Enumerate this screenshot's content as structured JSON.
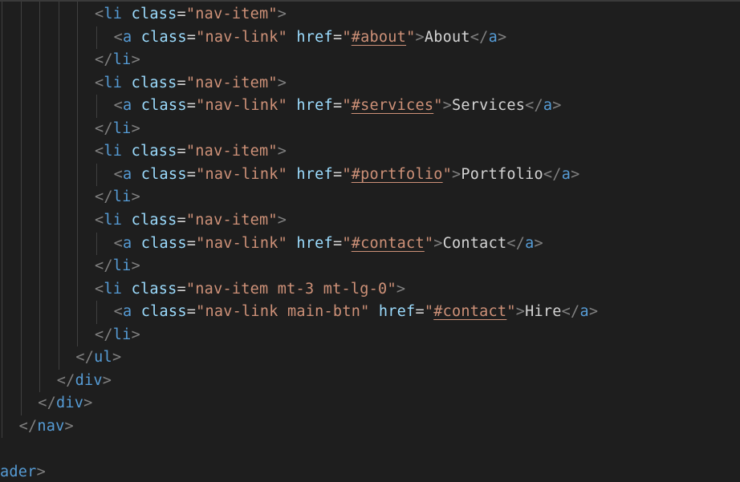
{
  "editor": {
    "lines": [
      {
        "indent": 5,
        "parts": [
          [
            "bracket",
            "<"
          ],
          [
            "tag",
            "li"
          ],
          [
            "sp",
            " "
          ],
          [
            "attr",
            "class"
          ],
          [
            "eq",
            "="
          ],
          [
            "str",
            "\"nav-item\""
          ],
          [
            "bracket",
            ">"
          ]
        ]
      },
      {
        "indent": 6,
        "parts": [
          [
            "bracket",
            "<"
          ],
          [
            "tag",
            "a"
          ],
          [
            "sp",
            " "
          ],
          [
            "attr",
            "class"
          ],
          [
            "eq",
            "="
          ],
          [
            "str",
            "\"nav-link\""
          ],
          [
            "sp",
            " "
          ],
          [
            "attr",
            "href"
          ],
          [
            "eq",
            "="
          ],
          [
            "str",
            "\""
          ],
          [
            "strlink",
            "#about"
          ],
          [
            "str",
            "\""
          ],
          [
            "bracket",
            ">"
          ],
          [
            "text",
            "About"
          ],
          [
            "bracket",
            "</"
          ],
          [
            "tag",
            "a"
          ],
          [
            "bracket",
            ">"
          ]
        ]
      },
      {
        "indent": 5,
        "parts": [
          [
            "bracket",
            "</"
          ],
          [
            "tag",
            "li"
          ],
          [
            "bracket",
            ">"
          ]
        ]
      },
      {
        "indent": 5,
        "parts": [
          [
            "bracket",
            "<"
          ],
          [
            "tag",
            "li"
          ],
          [
            "sp",
            " "
          ],
          [
            "attr",
            "class"
          ],
          [
            "eq",
            "="
          ],
          [
            "str",
            "\"nav-item\""
          ],
          [
            "bracket",
            ">"
          ]
        ]
      },
      {
        "indent": 6,
        "parts": [
          [
            "bracket",
            "<"
          ],
          [
            "tag",
            "a"
          ],
          [
            "sp",
            " "
          ],
          [
            "attr",
            "class"
          ],
          [
            "eq",
            "="
          ],
          [
            "str",
            "\"nav-link\""
          ],
          [
            "sp",
            " "
          ],
          [
            "attr",
            "href"
          ],
          [
            "eq",
            "="
          ],
          [
            "str",
            "\""
          ],
          [
            "strlink",
            "#services"
          ],
          [
            "str",
            "\""
          ],
          [
            "bracket",
            ">"
          ],
          [
            "text",
            "Services"
          ],
          [
            "bracket",
            "</"
          ],
          [
            "tag",
            "a"
          ],
          [
            "bracket",
            ">"
          ]
        ]
      },
      {
        "indent": 5,
        "parts": [
          [
            "bracket",
            "</"
          ],
          [
            "tag",
            "li"
          ],
          [
            "bracket",
            ">"
          ]
        ]
      },
      {
        "indent": 5,
        "parts": [
          [
            "bracket",
            "<"
          ],
          [
            "tag",
            "li"
          ],
          [
            "sp",
            " "
          ],
          [
            "attr",
            "class"
          ],
          [
            "eq",
            "="
          ],
          [
            "str",
            "\"nav-item\""
          ],
          [
            "bracket",
            ">"
          ]
        ]
      },
      {
        "indent": 6,
        "parts": [
          [
            "bracket",
            "<"
          ],
          [
            "tag",
            "a"
          ],
          [
            "sp",
            " "
          ],
          [
            "attr",
            "class"
          ],
          [
            "eq",
            "="
          ],
          [
            "str",
            "\"nav-link\""
          ],
          [
            "sp",
            " "
          ],
          [
            "attr",
            "href"
          ],
          [
            "eq",
            "="
          ],
          [
            "str",
            "\""
          ],
          [
            "strlink",
            "#portfolio"
          ],
          [
            "str",
            "\""
          ],
          [
            "bracket",
            ">"
          ],
          [
            "text",
            "Portfolio"
          ],
          [
            "bracket",
            "</"
          ],
          [
            "tag",
            "a"
          ],
          [
            "bracket",
            ">"
          ]
        ]
      },
      {
        "indent": 5,
        "parts": [
          [
            "bracket",
            "</"
          ],
          [
            "tag",
            "li"
          ],
          [
            "bracket",
            ">"
          ]
        ]
      },
      {
        "indent": 5,
        "parts": [
          [
            "bracket",
            "<"
          ],
          [
            "tag",
            "li"
          ],
          [
            "sp",
            " "
          ],
          [
            "attr",
            "class"
          ],
          [
            "eq",
            "="
          ],
          [
            "str",
            "\"nav-item\""
          ],
          [
            "bracket",
            ">"
          ]
        ]
      },
      {
        "indent": 6,
        "parts": [
          [
            "bracket",
            "<"
          ],
          [
            "tag",
            "a"
          ],
          [
            "sp",
            " "
          ],
          [
            "attr",
            "class"
          ],
          [
            "eq",
            "="
          ],
          [
            "str",
            "\"nav-link\""
          ],
          [
            "sp",
            " "
          ],
          [
            "attr",
            "href"
          ],
          [
            "eq",
            "="
          ],
          [
            "str",
            "\""
          ],
          [
            "strlink",
            "#contact"
          ],
          [
            "str",
            "\""
          ],
          [
            "bracket",
            ">"
          ],
          [
            "text",
            "Contact"
          ],
          [
            "bracket",
            "</"
          ],
          [
            "tag",
            "a"
          ],
          [
            "bracket",
            ">"
          ]
        ]
      },
      {
        "indent": 5,
        "parts": [
          [
            "bracket",
            "</"
          ],
          [
            "tag",
            "li"
          ],
          [
            "bracket",
            ">"
          ]
        ]
      },
      {
        "indent": 5,
        "parts": [
          [
            "bracket",
            "<"
          ],
          [
            "tag",
            "li"
          ],
          [
            "sp",
            " "
          ],
          [
            "attr",
            "class"
          ],
          [
            "eq",
            "="
          ],
          [
            "str",
            "\"nav-item mt-3 mt-lg-0\""
          ],
          [
            "bracket",
            ">"
          ]
        ]
      },
      {
        "indent": 6,
        "parts": [
          [
            "bracket",
            "<"
          ],
          [
            "tag",
            "a"
          ],
          [
            "sp",
            " "
          ],
          [
            "attr",
            "class"
          ],
          [
            "eq",
            "="
          ],
          [
            "str",
            "\"nav-link main-btn\""
          ],
          [
            "sp",
            " "
          ],
          [
            "attr",
            "href"
          ],
          [
            "eq",
            "="
          ],
          [
            "str",
            "\""
          ],
          [
            "strlink",
            "#contact"
          ],
          [
            "str",
            "\""
          ],
          [
            "bracket",
            ">"
          ],
          [
            "text",
            "Hire"
          ],
          [
            "bracket",
            "</"
          ],
          [
            "tag",
            "a"
          ],
          [
            "bracket",
            ">"
          ]
        ]
      },
      {
        "indent": 5,
        "parts": [
          [
            "bracket",
            "</"
          ],
          [
            "tag",
            "li"
          ],
          [
            "bracket",
            ">"
          ]
        ]
      },
      {
        "indent": 4,
        "parts": [
          [
            "bracket",
            "</"
          ],
          [
            "tag",
            "ul"
          ],
          [
            "bracket",
            ">"
          ]
        ]
      },
      {
        "indent": 3,
        "parts": [
          [
            "bracket",
            "</"
          ],
          [
            "tag",
            "div"
          ],
          [
            "bracket",
            ">"
          ]
        ]
      },
      {
        "indent": 2,
        "parts": [
          [
            "bracket",
            "</"
          ],
          [
            "tag",
            "div"
          ],
          [
            "bracket",
            ">"
          ]
        ]
      },
      {
        "indent": 1,
        "parts": [
          [
            "bracket",
            "</"
          ],
          [
            "tag",
            "nav"
          ],
          [
            "bracket",
            ">"
          ]
        ]
      },
      {
        "indent": 0,
        "parts": []
      },
      {
        "indent": 0,
        "parts": [
          [
            "tag",
            "ader"
          ],
          [
            "bracket",
            ">"
          ]
        ]
      }
    ]
  },
  "colors": {
    "background": "#1e1e1e",
    "tag": "#569cd6",
    "attribute": "#9cdcfe",
    "string": "#ce9178",
    "bracket": "#808080",
    "text": "#d4d4d4",
    "indent_guide": "#404040"
  }
}
